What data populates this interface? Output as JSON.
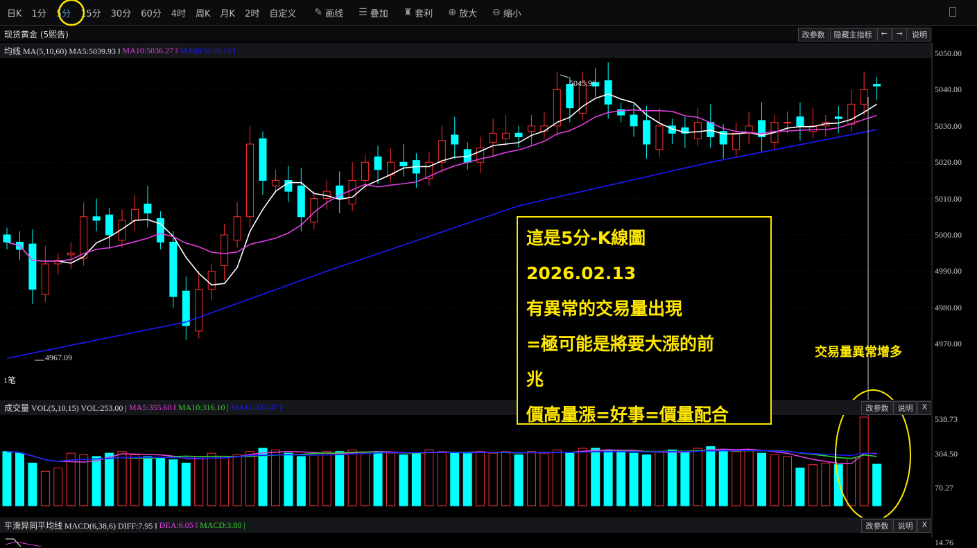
{
  "toolbar": {
    "periods": [
      "日K",
      "1分",
      "5分",
      "15分",
      "30分",
      "60分",
      "4时",
      "周K",
      "月K",
      "2时",
      "自定义"
    ],
    "active": "5分",
    "tools": [
      {
        "icon": "pencil-icon",
        "label": "画线"
      },
      {
        "icon": "database-stack-icon",
        "label": "叠加"
      },
      {
        "icon": "money-bag-icon",
        "label": "套利"
      },
      {
        "icon": "zoom-in-icon",
        "label": "放大"
      },
      {
        "icon": "zoom-out-icon",
        "label": "缩小"
      }
    ]
  },
  "instrument": "现货黄金 (5熙告)",
  "main_buttons": [
    "改参数",
    "隐藏主指标",
    "←",
    "→",
    "说明"
  ],
  "ma_legend": {
    "name": "均线 MA(5,10,60) MA5:5039.93 ‖",
    "ma10": "MA10:5036.27 ‖",
    "ma60": "MA60:5029.18 ‖"
  },
  "price_axis": [
    "5050.00",
    "5040.00",
    "5030.00",
    "5020.00",
    "5010.00",
    "5000.00",
    "4990.00",
    "4980.00",
    "4970.00"
  ],
  "high_label": "5045.96",
  "low_label": "4967.09",
  "unit_label": "1笔",
  "vol_legend": {
    "name": "成交量 VOL(5,10,15) VOL:253.00 |",
    "ma5": "MA5:355.60 ‖",
    "ma10": "MA10:316.10 |",
    "ma15": "MA15:337.47 |"
  },
  "vol_buttons": [
    "改参数",
    "说明",
    "X"
  ],
  "vol_axis": [
    "538.73",
    "304.50",
    "70.27"
  ],
  "macd_legend": {
    "name": "平滑异同平均线 MACD(6,38,6) DIFF:7.95 ‖",
    "dea": "DEA:6.05 ‖",
    "macd": "MACD:3.80 |"
  },
  "macd_buttons": [
    "改参数",
    "说明",
    "X"
  ],
  "macd_axis": "14.76",
  "annotation": {
    "lines": [
      "這是5分-K線圖",
      "2026.02.13",
      "有異常的交易量出現",
      "=極可能是將要大漲的前",
      "兆",
      "價高量漲=好事=價量配合"
    ],
    "side_note": "交易量異常增多"
  },
  "colors": {
    "up": "#ff3030",
    "down": "#00ffff",
    "ma5": "#ffffff",
    "ma10": "#e040e0",
    "ma60": "#1a1aff",
    "highlight": "#ffe800"
  },
  "chart_data": {
    "type": "candlestick",
    "ylim": [
      4962,
      5052
    ],
    "closes": [
      4998,
      4996,
      4985,
      4992,
      4993,
      4995,
      5005,
      5004,
      5000,
      5004,
      5007,
      5006,
      4998,
      4983,
      4975,
      4985,
      4990,
      5000,
      5005,
      5025,
      5015,
      5015,
      5012,
      5005,
      5010,
      5012,
      5010,
      5015,
      5020,
      5018,
      5020,
      5019,
      5017,
      5020,
      5026,
      5025,
      5020,
      5024,
      5028,
      5028,
      5027,
      5030,
      5030,
      5040,
      5035,
      5042,
      5041,
      5036,
      5033,
      5030,
      5025,
      5030,
      5028,
      5028,
      5031,
      5027,
      5025,
      5028,
      5030,
      5027,
      5031,
      5031,
      5030,
      5030,
      5031,
      5032,
      5036,
      5040,
      5041
    ],
    "volumes": [
      330,
      320,
      260,
      210,
      230,
      320,
      310,
      300,
      320,
      330,
      310,
      300,
      290,
      280,
      260,
      300,
      320,
      300,
      310,
      330,
      350,
      340,
      320,
      300,
      310,
      330,
      330,
      340,
      320,
      330,
      320,
      310,
      320,
      340,
      330,
      320,
      320,
      330,
      320,
      330,
      310,
      330,
      320,
      340,
      320,
      350,
      350,
      340,
      330,
      320,
      310,
      330,
      340,
      330,
      350,
      360,
      340,
      330,
      340,
      320,
      310,
      300,
      230,
      250,
      260,
      250,
      290,
      540,
      253
    ],
    "ma60_samples": [
      [
        0,
        4966
      ],
      [
        14,
        4976
      ],
      [
        25,
        4990
      ],
      [
        40,
        5008
      ],
      [
        55,
        5020
      ],
      [
        68,
        5029
      ]
    ]
  }
}
